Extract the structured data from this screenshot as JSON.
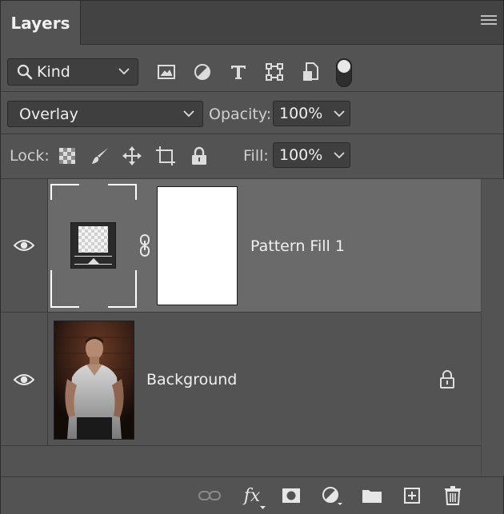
{
  "panel": {
    "tab_label": "Layers"
  },
  "filter": {
    "kind_label": "Kind",
    "icons": [
      "image-filter-icon",
      "adjustment-filter-icon",
      "type-filter-icon",
      "shape-filter-icon",
      "smart-object-filter-icon",
      "filter-toggle-icon"
    ]
  },
  "blend": {
    "mode": "Overlay",
    "opacity_label": "Opacity:",
    "opacity_value": "100%"
  },
  "lock": {
    "label": "Lock:",
    "icons": [
      "lock-transparency-icon",
      "lock-image-icon",
      "lock-position-icon",
      "lock-artboard-icon",
      "lock-all-icon"
    ],
    "fill_label": "Fill:",
    "fill_value": "100%"
  },
  "layers": [
    {
      "name": "Pattern Fill 1",
      "selected": true,
      "visible": true
    },
    {
      "name": "Background",
      "selected": false,
      "visible": true,
      "locked": true
    }
  ],
  "bottom_icons": [
    "link-layers-icon",
    "fx-icon",
    "add-mask-icon",
    "adjustment-layer-icon",
    "group-folder-icon",
    "new-layer-icon",
    "trash-icon"
  ],
  "bottom": {
    "fx_label": "fx"
  },
  "colors": {
    "panel_bg": "#535353",
    "selected_row": "#6a6a6a",
    "field_bg": "#3f3f3f"
  }
}
